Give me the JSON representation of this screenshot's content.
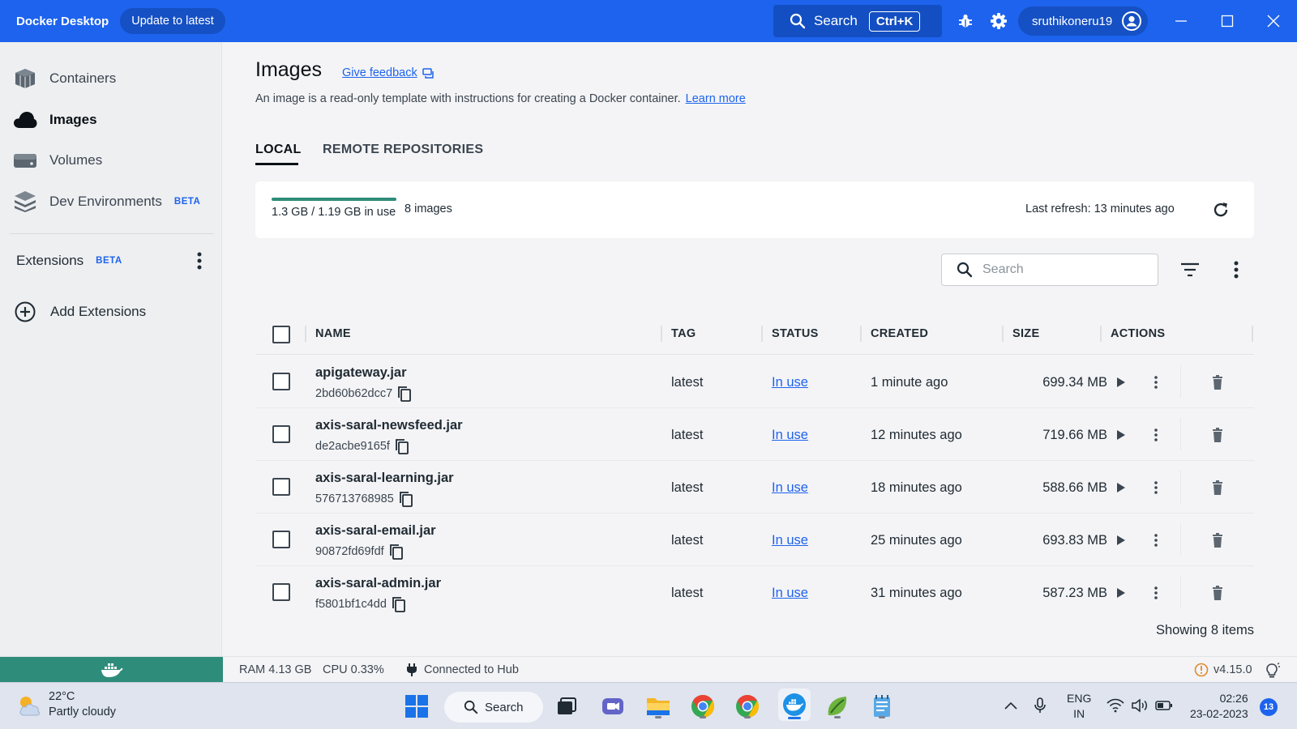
{
  "titlebar": {
    "app_name": "Docker Desktop",
    "update_label": "Update to latest",
    "search_label": "Search",
    "search_shortcut": "Ctrl+K",
    "username": "sruthikoneru19"
  },
  "sidebar": {
    "items": [
      {
        "label": "Containers",
        "icon": "containers-icon"
      },
      {
        "label": "Images",
        "icon": "images-cloud-icon",
        "active": true
      },
      {
        "label": "Volumes",
        "icon": "volumes-icon"
      },
      {
        "label": "Dev Environments",
        "icon": "dev-environments-icon",
        "badge": "BETA"
      }
    ],
    "extensions_label": "Extensions",
    "extensions_badge": "BETA",
    "add_extensions_label": "Add Extensions"
  },
  "page": {
    "title": "Images",
    "feedback_label": "Give feedback",
    "subtitle": "An image is a read-only template with instructions for creating a Docker container.",
    "learn_more": "Learn more",
    "tabs": [
      "LOCAL",
      "REMOTE REPOSITORIES"
    ],
    "active_tab": "LOCAL"
  },
  "usage": {
    "text": "1.3 GB / 1.19 GB in use",
    "fill_fraction": 1.0,
    "bar_color": "#2e8c7a",
    "image_count": "8 images",
    "last_refresh": "Last refresh: 13 minutes ago"
  },
  "table": {
    "search_placeholder": "Search",
    "columns": [
      "NAME",
      "TAG",
      "STATUS",
      "CREATED",
      "SIZE",
      "ACTIONS"
    ],
    "rows": [
      {
        "name": "apigateway.jar",
        "id": "2bd60b62dcc7",
        "tag": "latest",
        "status": "In use",
        "created": "1 minute ago",
        "size": "699.34 MB"
      },
      {
        "name": "axis-saral-newsfeed.jar",
        "id": "de2acbe9165f",
        "tag": "latest",
        "status": "In use",
        "created": "12 minutes ago",
        "size": "719.66 MB"
      },
      {
        "name": "axis-saral-learning.jar",
        "id": "576713768985",
        "tag": "latest",
        "status": "In use",
        "created": "18 minutes ago",
        "size": "588.66 MB"
      },
      {
        "name": "axis-saral-email.jar",
        "id": "90872fd69fdf",
        "tag": "latest",
        "status": "In use",
        "created": "25 minutes ago",
        "size": "693.83 MB"
      },
      {
        "name": "axis-saral-admin.jar",
        "id": "f5801bf1c4dd",
        "tag": "latest",
        "status": "In use",
        "created": "31 minutes ago",
        "size": "587.23 MB"
      }
    ],
    "showing": "Showing 8 items"
  },
  "footer": {
    "ram": "RAM 4.13 GB",
    "cpu": "CPU 0.33%",
    "hub_status": "Connected to Hub",
    "version": "v4.15.0"
  },
  "taskbar": {
    "temperature": "22°C",
    "weather": "Partly cloudy",
    "search_label": "Search",
    "lang_line1": "ENG",
    "lang_line2": "IN",
    "time": "02:26",
    "date": "23-02-2023",
    "notification_count": "13"
  },
  "colors": {
    "brand_blue": "#1d63ed",
    "engine_green": "#2e8c7a",
    "link_blue": "#1d63ed"
  }
}
